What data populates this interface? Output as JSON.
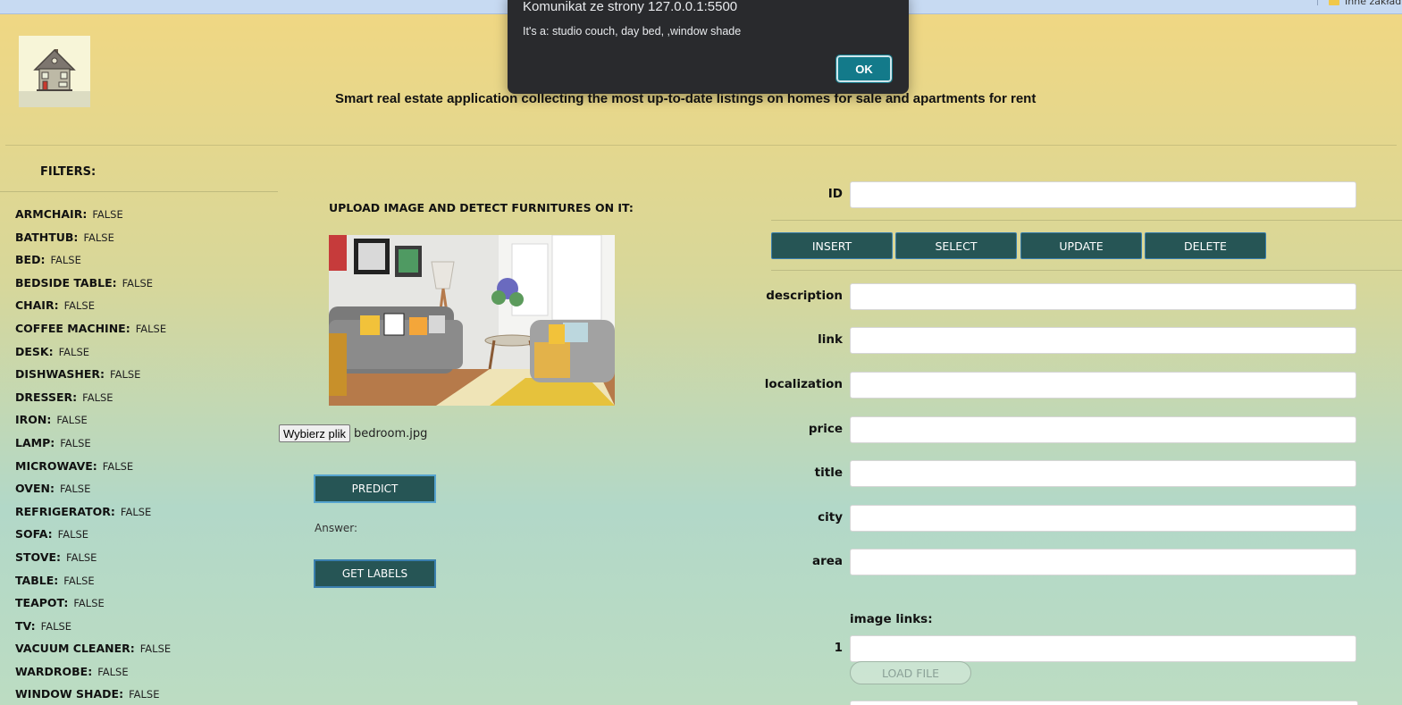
{
  "browser": {
    "bookmark_label": "Inne zakładki"
  },
  "app": {
    "title": "Smart real estate application collecting the most up-to-date listings on homes for sale and apartments for rent"
  },
  "filters": {
    "title": "FILTERS:",
    "items": [
      {
        "name": "ARMCHAIR:",
        "value": "FALSE"
      },
      {
        "name": "BATHTUB:",
        "value": "FALSE"
      },
      {
        "name": "BED:",
        "value": "FALSE"
      },
      {
        "name": "BEDSIDE TABLE:",
        "value": "FALSE"
      },
      {
        "name": "CHAIR:",
        "value": "FALSE"
      },
      {
        "name": "COFFEE MACHINE:",
        "value": "FALSE"
      },
      {
        "name": "DESK:",
        "value": "FALSE"
      },
      {
        "name": "DISHWASHER:",
        "value": "FALSE"
      },
      {
        "name": "DRESSER:",
        "value": "FALSE"
      },
      {
        "name": "IRON:",
        "value": "FALSE"
      },
      {
        "name": "LAMP:",
        "value": "FALSE"
      },
      {
        "name": "MICROWAVE:",
        "value": "FALSE"
      },
      {
        "name": "OVEN:",
        "value": "FALSE"
      },
      {
        "name": "REFRIGERATOR:",
        "value": "FALSE"
      },
      {
        "name": "SOFA:",
        "value": "FALSE"
      },
      {
        "name": "STOVE:",
        "value": "FALSE"
      },
      {
        "name": "TABLE:",
        "value": "FALSE"
      },
      {
        "name": "TEAPOT:",
        "value": "FALSE"
      },
      {
        "name": "TV:",
        "value": "FALSE"
      },
      {
        "name": "VACUUM CLEANER:",
        "value": "FALSE"
      },
      {
        "name": "WARDROBE:",
        "value": "FALSE"
      },
      {
        "name": "WINDOW SHADE:",
        "value": "FALSE"
      }
    ]
  },
  "upload": {
    "title": "UPLOAD IMAGE AND DETECT FURNITURES ON IT:",
    "file_button": "Wybierz plik",
    "file_name": "bedroom.jpg",
    "predict_label": "PREDICT",
    "answer_label": "Answer:",
    "get_labels_label": "GET LABELS"
  },
  "form": {
    "id_label": "ID",
    "crud": {
      "insert": "INSERT",
      "select": "SELECT",
      "update": "UPDATE",
      "delete": "DELETE"
    },
    "fields": {
      "description": "description",
      "link": "link",
      "localization": "localization",
      "price": "price",
      "title": "title",
      "city": "city",
      "area": "area"
    },
    "image_links_label": "image links:",
    "image_link_index": "1",
    "load_file_label": "LOAD FILE"
  },
  "dialog": {
    "title": "Komunikat ze strony 127.0.0.1:5500",
    "message": "It's a: studio couch, day bed, ,window shade",
    "ok_label": "OK"
  },
  "colors": {
    "button_dark": "#265555",
    "dialog_bg": "#292a2d",
    "dialog_ok": "#137a8a"
  }
}
